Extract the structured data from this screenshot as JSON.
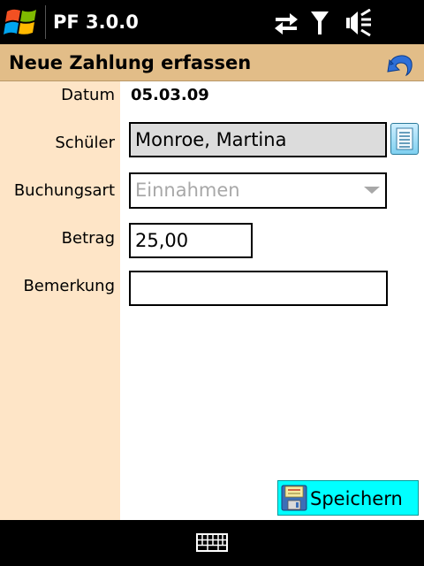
{
  "status_bar": {
    "app_title": "PF 3.0.0",
    "icons": [
      "windows-start-icon",
      "data-sync-icon",
      "signal-antenna-icon",
      "speaker-muted-icon"
    ]
  },
  "header": {
    "title": "Neue Zahlung erfassen",
    "back_icon": "undo-arrow-icon"
  },
  "form": {
    "datum": {
      "label": "Datum",
      "value": "05.03.09"
    },
    "schueler": {
      "label": "Schüler",
      "value": "Monroe, Martina",
      "lookup_icon": "list-lookup-icon"
    },
    "buchungsart": {
      "label": "Buchungsart",
      "value": "Einnahmen"
    },
    "betrag": {
      "label": "Betrag",
      "value": "25,00"
    },
    "bemerkung": {
      "label": "Bemerkung",
      "value": ""
    }
  },
  "actions": {
    "save_label": "Speichern",
    "save_icon": "floppy-disk-icon"
  },
  "softbar": {
    "keyboard_icon": "keyboard-icon"
  },
  "colors": {
    "header_bg": "#E2BD88",
    "label_column_bg": "#FEE5C7",
    "readonly_field_bg": "#DCDCDC",
    "save_button_bg": "#00FFFF",
    "disabled_text": "#A8A8A8"
  }
}
